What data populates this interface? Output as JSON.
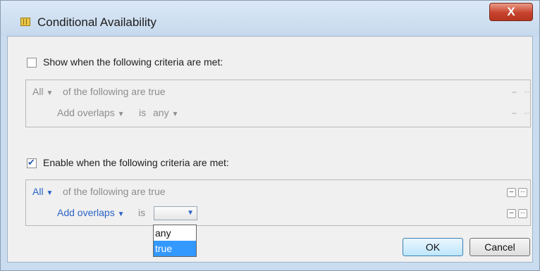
{
  "window": {
    "title": "Conditional Availability",
    "close_label": "X"
  },
  "show_section": {
    "checkbox_label": "Show when the following criteria are met:",
    "checked": false,
    "row1": {
      "quantifier": "All",
      "rest": "of the following are true",
      "remove": "–",
      "add": "··"
    },
    "row2": {
      "field": "Add overlaps",
      "op": "is",
      "value": "any",
      "remove": "–",
      "add": "··"
    }
  },
  "enable_section": {
    "checkbox_label": "Enable when the following criteria are met:",
    "checked": true,
    "row1": {
      "quantifier": "All",
      "rest": "of the following are true",
      "remove": "–",
      "add": "··"
    },
    "row2": {
      "field": "Add overlaps",
      "op": "is",
      "value": "",
      "remove": "–",
      "add": "··"
    }
  },
  "dropdown": {
    "options": [
      "any",
      "true"
    ],
    "highlighted": "true"
  },
  "buttons": {
    "ok": "OK",
    "cancel": "Cancel"
  },
  "icons": {
    "caret": "▼",
    "check": "check-icon",
    "app": "dialog-icon"
  }
}
